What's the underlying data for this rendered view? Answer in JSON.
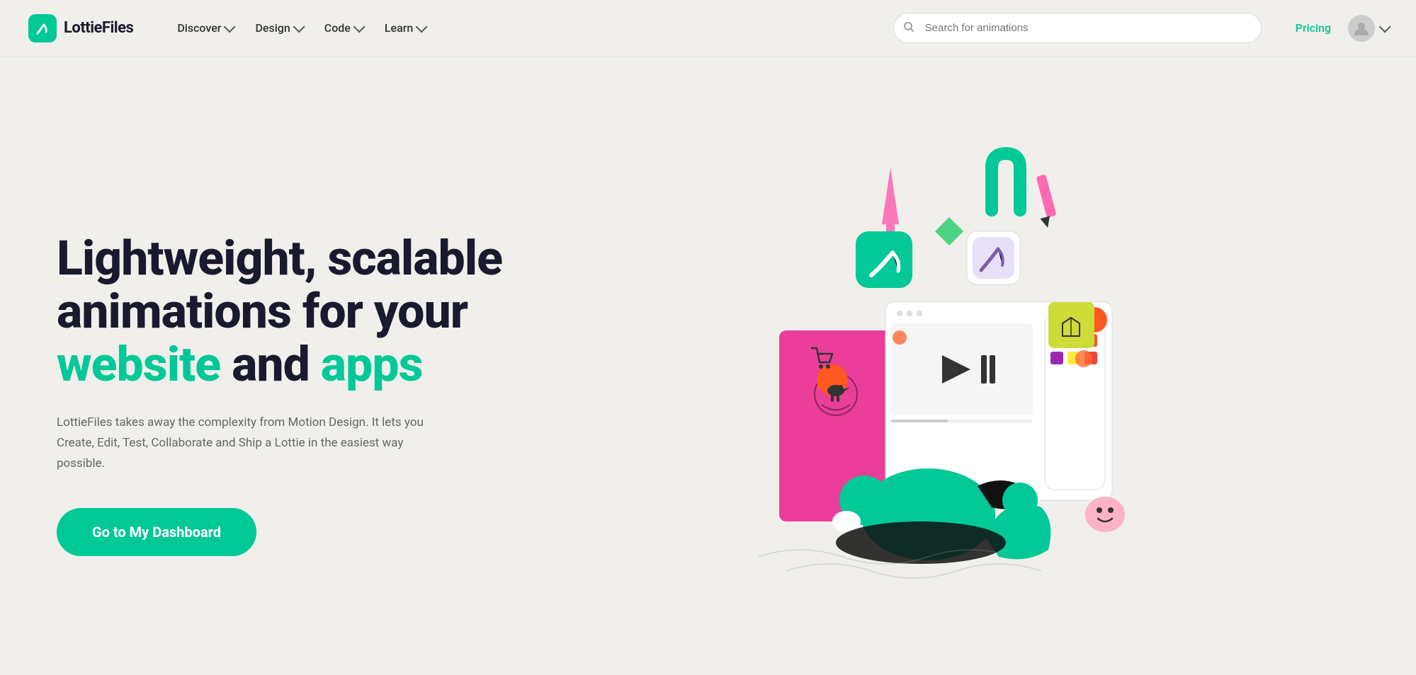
{
  "brand": {
    "name": "LottieFiles",
    "logo_alt": "LottieFiles Logo",
    "logo_bg": "#00C897"
  },
  "navbar": {
    "links": [
      {
        "label": "Discover",
        "has_dropdown": true
      },
      {
        "label": "Design",
        "has_dropdown": true
      },
      {
        "label": "Code",
        "has_dropdown": true
      },
      {
        "label": "Learn",
        "has_dropdown": true
      }
    ],
    "search_placeholder": "Search for animations",
    "pricing_label": "Pricing"
  },
  "hero": {
    "title_line1": "Lightweight, scalable",
    "title_line2": "animations for your",
    "title_accent1": "website",
    "title_mid": " and ",
    "title_accent2": "apps",
    "description": "LottieFiles takes away the complexity from Motion Design. It lets you Create, Edit, Test, Collaborate and Ship a Lottie in the easiest way possible.",
    "cta_label": "Go to My Dashboard"
  },
  "colors": {
    "brand_green": "#00C897",
    "text_dark": "#1a1a2e",
    "text_gray": "#666666",
    "bg": "#f0efeb"
  }
}
